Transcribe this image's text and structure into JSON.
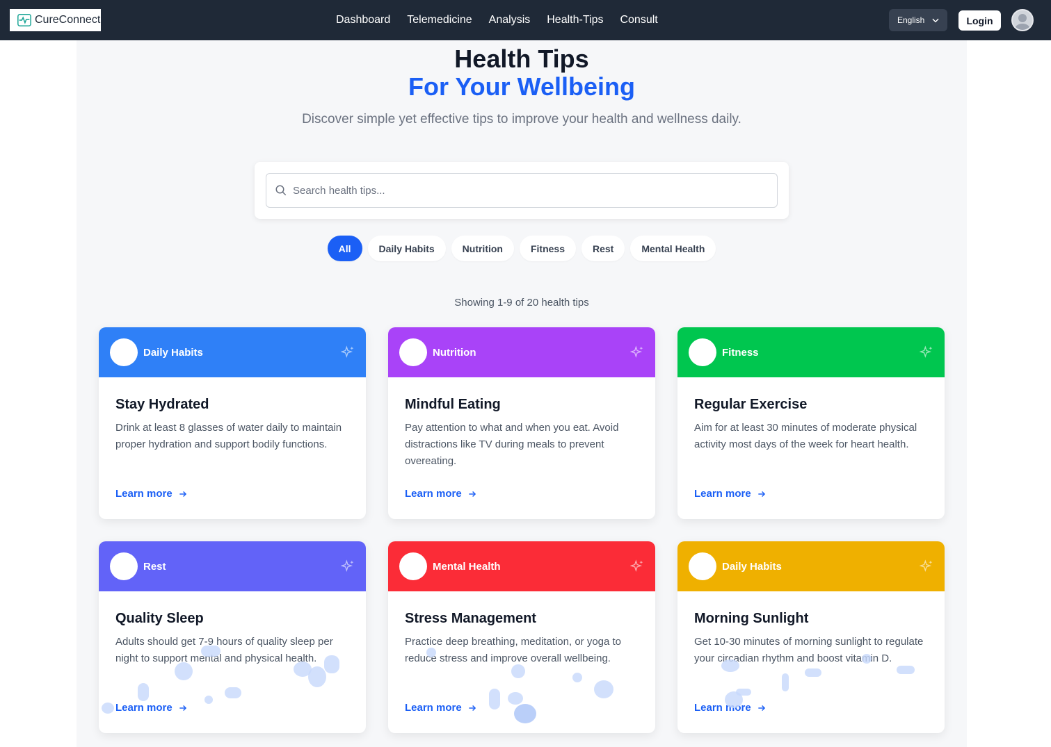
{
  "nav": {
    "brand": "CureConnect",
    "links": [
      "Dashboard",
      "Telemedicine",
      "Analysis",
      "Health-Tips",
      "Consult"
    ],
    "language": "English",
    "login": "Login"
  },
  "hero": {
    "title": "Health Tips",
    "title_accent": "For Your Wellbeing",
    "subtitle": "Discover simple yet effective tips to improve your health and wellness daily."
  },
  "search": {
    "placeholder": "Search health tips..."
  },
  "filters": [
    "All",
    "Daily Habits",
    "Nutrition",
    "Fitness",
    "Rest",
    "Mental Health"
  ],
  "showing": "Showing 1-9 of 20 health tips",
  "cards": [
    {
      "category": "Daily Habits",
      "title": "Stay Hydrated",
      "desc": "Drink at least 8 glasses of water daily to maintain proper hydration and support bodily functions.",
      "link": "Learn more",
      "color": "#2f80f7"
    },
    {
      "category": "Nutrition",
      "title": "Mindful Eating",
      "desc": "Pay attention to what and when you eat. Avoid distractions like TV during meals to prevent overeating.",
      "link": "Learn more",
      "color": "#a943f8"
    },
    {
      "category": "Fitness",
      "title": "Regular Exercise",
      "desc": "Aim for at least 30 minutes of moderate physical activity most days of the week for heart health.",
      "link": "Learn more",
      "color": "#00c64f"
    },
    {
      "category": "Rest",
      "title": "Quality Sleep",
      "desc": "Adults should get 7-9 hours of quality sleep per night to support mental and physical health.",
      "link": "Learn more",
      "color": "#6263f8"
    },
    {
      "category": "Mental Health",
      "title": "Stress Management",
      "desc": "Practice deep breathing, meditation, or yoga to reduce stress and improve overall wellbeing.",
      "link": "Learn more",
      "color": "#fb2c37"
    },
    {
      "category": "Daily Habits",
      "title": "Morning Sunlight",
      "desc": "Get 10-30 minutes of morning sunlight to regulate your circadian rhythm and boost vitamin D.",
      "link": "Learn more",
      "color": "#efb000"
    }
  ],
  "colors": {
    "navbar": "#1f2937",
    "accent": "#1b5ff5",
    "page_bg": "#f6f7f9"
  }
}
